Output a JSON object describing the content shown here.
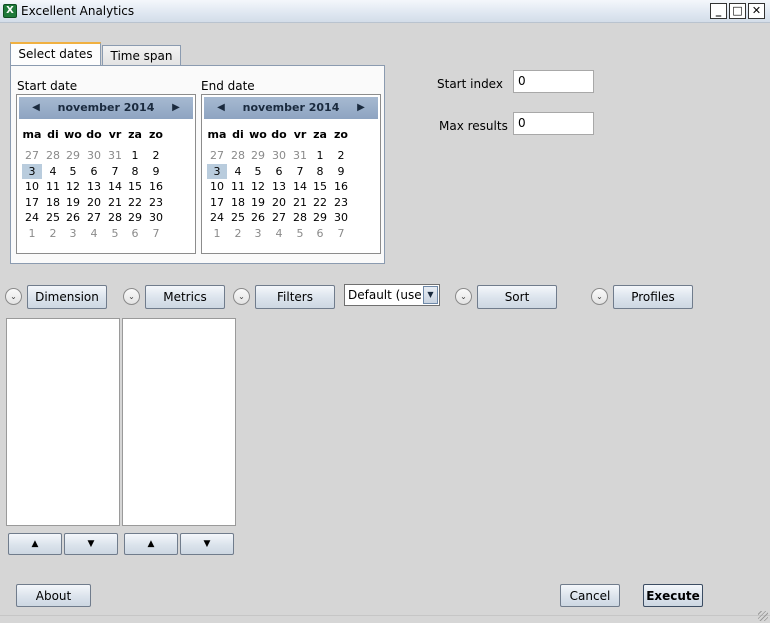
{
  "window": {
    "app_icon": "X",
    "title": "Excellent Analytics",
    "minimize": "_",
    "maximize": "□",
    "close": "✕"
  },
  "tabs": [
    {
      "label": "Select dates",
      "active": true
    },
    {
      "label": "Time span",
      "active": false
    }
  ],
  "dates": {
    "start_label": "Start date",
    "end_label": "End date",
    "start_calendar": {
      "month": "november 2014",
      "prev": "◀",
      "next": "▶",
      "selected_day": "3"
    },
    "end_calendar": {
      "month": "november 2014",
      "prev": "◀",
      "next": "▶",
      "selected_day": "3"
    },
    "weekdays": [
      "ma",
      "di",
      "wo",
      "do",
      "vr",
      "za",
      "zo"
    ],
    "weeks": [
      [
        "27",
        "28",
        "29",
        "30",
        "31",
        "1",
        "2"
      ],
      [
        "3",
        "4",
        "5",
        "6",
        "7",
        "8",
        "9"
      ],
      [
        "10",
        "11",
        "12",
        "13",
        "14",
        "15",
        "16"
      ],
      [
        "17",
        "18",
        "19",
        "20",
        "21",
        "22",
        "23"
      ],
      [
        "24",
        "25",
        "26",
        "27",
        "28",
        "29",
        "30"
      ],
      [
        "1",
        "2",
        "3",
        "4",
        "5",
        "6",
        "7"
      ]
    ]
  },
  "params": {
    "start_index_label": "Start index",
    "start_index_value": "0",
    "max_results_label": "Max results",
    "max_results_value": "0"
  },
  "query": {
    "expander_icon": "⌄",
    "dimension": "Dimension",
    "metrics": "Metrics",
    "filters": "Filters",
    "segment_value": "Default (use if",
    "segment_arrow": "▼",
    "sort": "Sort",
    "profiles": "Profiles",
    "up": "▲",
    "down": "▼"
  },
  "footer": {
    "about": "About",
    "cancel": "Cancel",
    "execute": "Execute"
  }
}
